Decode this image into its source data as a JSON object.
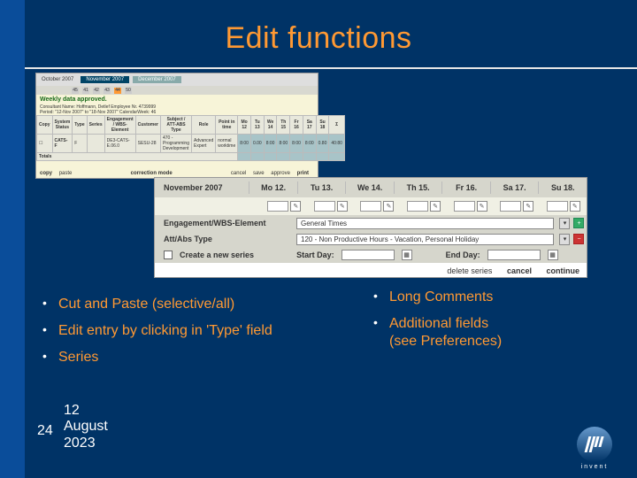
{
  "title": "Edit functions",
  "shot1": {
    "months": [
      "October 2007",
      "November 2007",
      "December 2007"
    ],
    "weeks": [
      "45",
      "41",
      "42",
      "43",
      "44",
      "50"
    ],
    "approved": "Weekly data approved.",
    "meta1": "Consultant Name: Hoffmann, Detlef    Employee Nr. 4739999",
    "meta2": "Period: \"12-Nov 2007\" to \"18-Nov 2007\"    CalendarWeek: 46",
    "headers": [
      "Copy",
      "System Status",
      "Type",
      "Series",
      "Engagement / WBS-Element",
      "Customer",
      "Subject / ATT-ABS Type",
      "Role",
      "Point in time",
      "Mo 12",
      "Tu 13",
      "We 14",
      "Th 15",
      "Fr 16",
      "Sa 17",
      "Su 18",
      "Σ"
    ],
    "row": {
      "code": "CATS-F",
      "type": "F",
      "wbs": "DE3-CATS-E.06.0",
      "cust": "SESU-28",
      "subject": "470 - Programming Development",
      "role": "Advanced Expert",
      "pit": "normal worktime",
      "vals": [
        "8:00",
        "0.00",
        "8:00",
        "8:00",
        "8:00",
        "8:00",
        "0.80",
        "40:80"
      ]
    },
    "totals_label": "Totals",
    "bottom": [
      "copy",
      "paste",
      "correction mode",
      "cancel",
      "save",
      "approve",
      "print"
    ]
  },
  "shot2": {
    "month_col": "November 2007",
    "days": [
      "Mo 12.",
      "Tu 13.",
      "We 14.",
      "Th 15.",
      "Fr 16.",
      "Sa 17.",
      "Su 18."
    ],
    "eng_label": "Engagement/WBS-Element",
    "eng_value": "General Times",
    "att_label": "Att/Abs Type",
    "att_value": "120 - Non Productive Hours - Vacation, Personal Holiday",
    "create_label": "Create a new series",
    "start_label": "Start Day:",
    "end_label": "End Day:",
    "links": [
      "delete series",
      "cancel",
      "continue"
    ]
  },
  "bullets_left": [
    "Cut and Paste (selective/all)",
    "Edit entry by clicking in 'Type' field",
    "Series"
  ],
  "bullets_right": [
    {
      "line1": "Long Comments"
    },
    {
      "line1": "Additional fields",
      "line2": "(see Preferences)"
    }
  ],
  "footer": {
    "num": "24",
    "date_l1": "12",
    "date_l2": "August",
    "date_l3": "2023"
  },
  "hp": "invent"
}
